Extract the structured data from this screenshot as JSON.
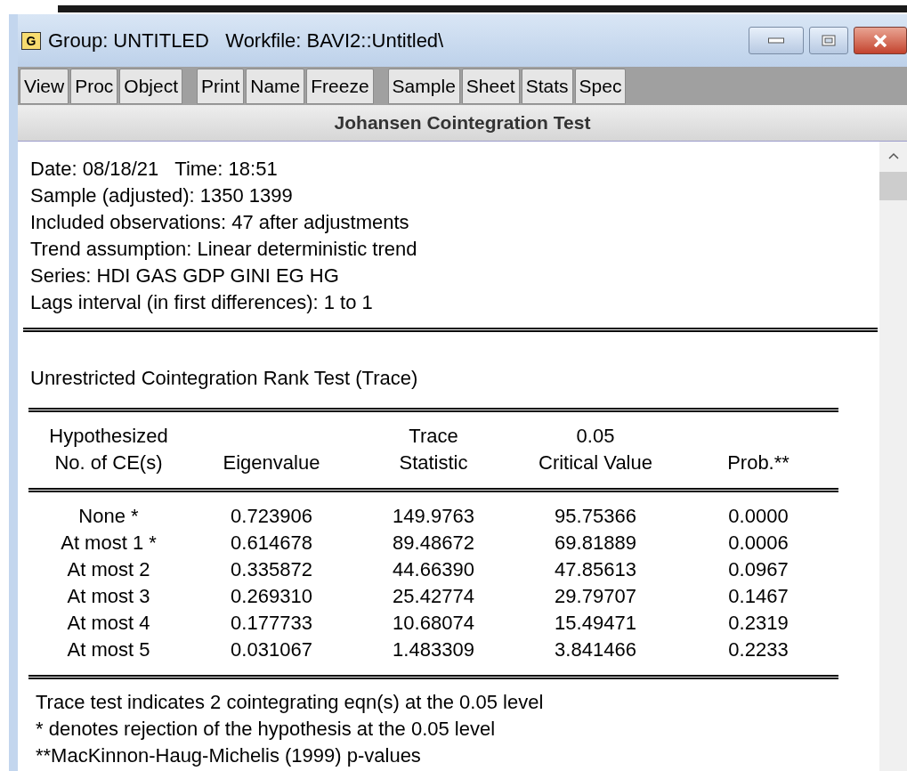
{
  "window": {
    "badge": "G",
    "title": "Group: UNTITLED   Workfile: BAVI2::Untitled\\"
  },
  "toolbar": [
    [
      "View",
      "Proc",
      "Object"
    ],
    [
      "Print",
      "Name",
      "Freeze"
    ],
    [
      "Sample",
      "Sheet",
      "Stats",
      "Spec"
    ]
  ],
  "view_title": "Johansen Cointegration Test",
  "info_lines": [
    "Date: 08/18/21   Time: 18:51",
    "Sample (adjusted): 1350 1399",
    "Included observations: 47 after adjustments",
    "Trend assumption: Linear deterministic trend",
    "Series: HDI GAS GDP GINI EG HG",
    "Lags interval (in first differences): 1 to 1"
  ],
  "section_title": "Unrestricted Cointegration Rank Test (Trace)",
  "table": {
    "columns": [
      "Hypothesized\nNo. of CE(s)",
      "Eigenvalue",
      "Trace\nStatistic",
      "0.05\nCritical Value",
      "Prob.**"
    ],
    "rows": [
      [
        "None *",
        "0.723906",
        "149.9763",
        "95.75366",
        "0.0000"
      ],
      [
        "At most 1 *",
        "0.614678",
        "89.48672",
        "69.81889",
        "0.0006"
      ],
      [
        "At most 2",
        "0.335872",
        "44.66390",
        "47.85613",
        "0.0967"
      ],
      [
        "At most 3",
        "0.269310",
        "25.42774",
        "29.79707",
        "0.1467"
      ],
      [
        "At most 4",
        "0.177733",
        "10.68074",
        "15.49471",
        "0.2319"
      ],
      [
        "At most 5",
        "0.031067",
        "1.483309",
        "3.841466",
        "0.2233"
      ]
    ]
  },
  "notes": [
    "Trace test indicates 2 cointegrating eqn(s) at the 0.05 level",
    "* denotes rejection of the hypothesis at the 0.05 level",
    "**MacKinnon-Haug-Michelis (1999) p-values"
  ]
}
